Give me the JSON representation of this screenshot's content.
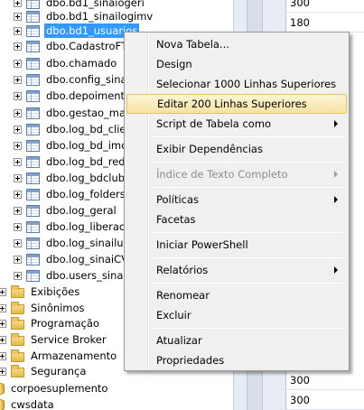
{
  "tree": {
    "tables": [
      {
        "label": "dbo.bd1_sinaiogeri",
        "selected": false
      },
      {
        "label": "dbo.bd1_sinailogimv",
        "selected": false
      },
      {
        "label": "dbo.bd1_usuarios",
        "selected": true
      },
      {
        "label": "dbo.CadastroFT",
        "selected": false
      },
      {
        "label": "dbo.chamado",
        "selected": false
      },
      {
        "label": "dbo.config_sina",
        "selected": false
      },
      {
        "label": "dbo.depoimento",
        "selected": false
      },
      {
        "label": "dbo.gestao_map",
        "selected": false
      },
      {
        "label": "dbo.log_bd_clie",
        "selected": false
      },
      {
        "label": "dbo.log_bd_imc",
        "selected": false
      },
      {
        "label": "dbo.log_bd_rede",
        "selected": false
      },
      {
        "label": "dbo.log_bdclub",
        "selected": false
      },
      {
        "label": "dbo.log_folders",
        "selected": false
      },
      {
        "label": "dbo.log_geral",
        "selected": false
      },
      {
        "label": "dbo.log_liberaca",
        "selected": false
      },
      {
        "label": "dbo.log_sinailul",
        "selected": false
      },
      {
        "label": "dbo.log_sinaiCV",
        "selected": false
      },
      {
        "label": "dbo.users_sinai",
        "selected": false
      }
    ],
    "folders": [
      {
        "label": "Exibições"
      },
      {
        "label": "Sinônimos"
      },
      {
        "label": "Programação"
      },
      {
        "label": "Service Broker"
      },
      {
        "label": "Armazenamento"
      },
      {
        "label": "Segurança"
      }
    ],
    "databases": [
      {
        "label": "corpoesuplemento"
      },
      {
        "label": "cwsdata"
      }
    ]
  },
  "grid": {
    "top_values": [
      "300",
      "180"
    ],
    "bottom_values": [
      "300",
      "300"
    ]
  },
  "context_menu": {
    "items": [
      {
        "label": "Nova Tabela...",
        "submenu": false,
        "disabled": false,
        "highlighted": false
      },
      {
        "label": "Design",
        "submenu": false,
        "disabled": false,
        "highlighted": false
      },
      {
        "label": "Selecionar 1000 Linhas Superiores",
        "submenu": false,
        "disabled": false,
        "highlighted": false
      },
      {
        "label": "Editar 200 Linhas Superiores",
        "submenu": false,
        "disabled": false,
        "highlighted": true
      },
      {
        "label": "Script de Tabela como",
        "submenu": true,
        "disabled": false,
        "highlighted": false
      },
      {
        "label": "Exibir Dependências",
        "submenu": false,
        "disabled": false,
        "highlighted": false
      },
      {
        "label": "Índice de Texto Completo",
        "submenu": true,
        "disabled": true,
        "highlighted": false
      },
      {
        "label": "Políticas",
        "submenu": true,
        "disabled": false,
        "highlighted": false
      },
      {
        "label": "Facetas",
        "submenu": false,
        "disabled": false,
        "highlighted": false
      },
      {
        "label": "Iniciar PowerShell",
        "submenu": false,
        "disabled": false,
        "highlighted": false
      },
      {
        "label": "Relatórios",
        "submenu": true,
        "disabled": false,
        "highlighted": false
      },
      {
        "label": "Renomear",
        "submenu": false,
        "disabled": false,
        "highlighted": false
      },
      {
        "label": "Excluir",
        "submenu": false,
        "disabled": false,
        "highlighted": false
      },
      {
        "label": "Atualizar",
        "submenu": false,
        "disabled": false,
        "highlighted": false
      },
      {
        "label": "Propriedades",
        "submenu": false,
        "disabled": false,
        "highlighted": false
      }
    ]
  },
  "colors": {
    "selection": "#3399ff",
    "menu_highlight": "#f6e3a3",
    "menu_background": "#f0f0f0"
  }
}
